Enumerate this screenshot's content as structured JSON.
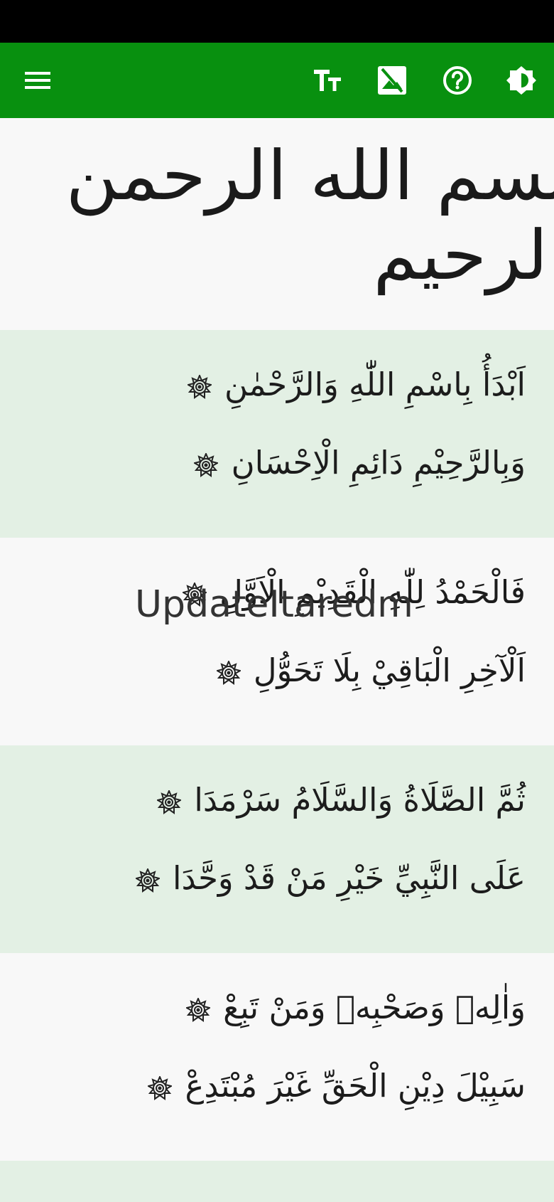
{
  "colors": {
    "status_bar": "#000000",
    "app_bar": "#08900f",
    "row_tint": "#e3f0e4",
    "background": "#f8f8f8",
    "text": "#1c1c1c"
  },
  "toolbar": {
    "icons": [
      "menu-icon",
      "text-size-icon",
      "no-image-icon",
      "help-icon",
      "brightness-icon"
    ]
  },
  "banner": {
    "text": "بسم الله الرحمن الرحيم"
  },
  "verses": [
    {
      "line1": "اَبْدَأُ بِاسْمِ اللّٰهِ وَالرَّحْمٰنِ",
      "line2": "وَبِالرَّحِيْمِ دَائِمِ الْاِحْسَانِ"
    },
    {
      "line1": "فَالْحَمْدُ لِلّٰهِ الْقَدِيْمِ الْاَوَّلِ",
      "line2": "اَلْآخِرِ الْبَاقِيْ بِلَا تَحَوُّلِ"
    },
    {
      "line1": "ثُمَّ الصَّلَاةُ وَالسَّلَامُ سَرْمَدَا",
      "line2": "عَلَى النَّبِيِّ خَيْرِ مَنْ قَدْ وَحَّدَا"
    },
    {
      "line1": "وَاٰلِهٖ وَصَحْبِهٖ وَمَنْ تَبِعْ",
      "line2": "سَبِيْلَ دِيْنِ الْحَقِّ غَيْرَ مُبْتَدِعْ"
    }
  ],
  "overlay": {
    "text": "UpdateItaredm"
  }
}
